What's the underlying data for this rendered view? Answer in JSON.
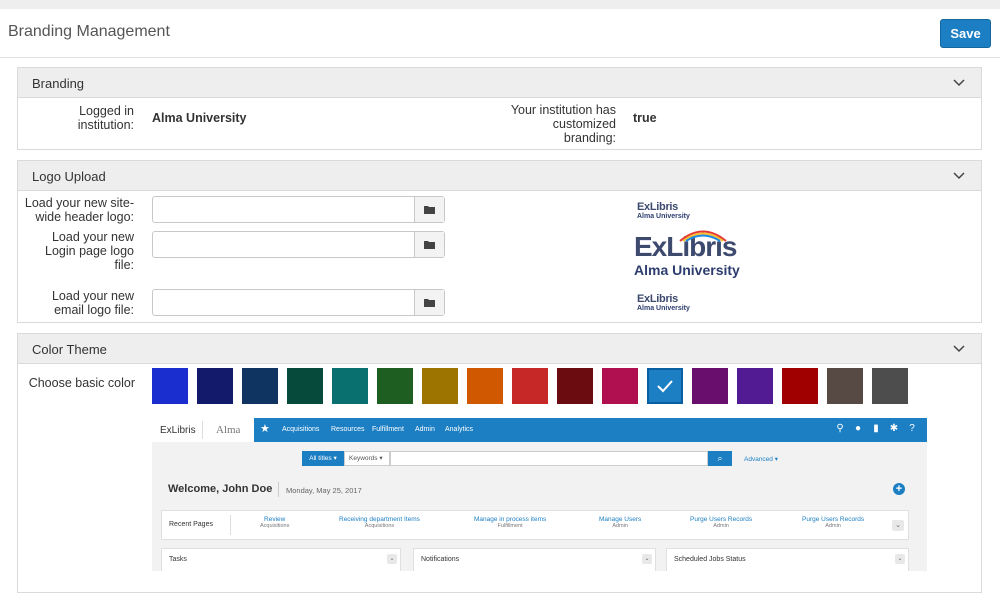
{
  "page": {
    "title": "Branding Management",
    "save_label": "Save"
  },
  "branding": {
    "header": "Branding",
    "logged_label": "Logged in institution:",
    "logged_value": "Alma University",
    "customized_label": "Your institution has customized branding:",
    "customized_value": "true"
  },
  "logo_upload": {
    "header": "Logo Upload",
    "header_logo_label": "Load your new site-wide header logo:",
    "login_logo_label": "Load your new Login page logo file:",
    "email_logo_label": "Load your new email logo file:",
    "logo_brand": "ExLibris",
    "logo_sub": "Alma University"
  },
  "color_theme": {
    "header": "Color Theme",
    "choose_label": "Choose basic color",
    "swatches": [
      "#1a2ecf",
      "#131a6b",
      "#0f3461",
      "#064a3c",
      "#0a6f6f",
      "#1e5e20",
      "#9e7400",
      "#d05800",
      "#c62828",
      "#6b0d10",
      "#b0104f",
      "#1c7fc4",
      "#6a0e6e",
      "#521b93",
      "#a00000",
      "#574a44",
      "#4d4d4d"
    ],
    "selected_index": 11
  },
  "preview": {
    "brand": "ExLibris",
    "alma": "Alma",
    "nav": [
      "Acquisitions",
      "Resources",
      "Fulfillment",
      "Admin",
      "Analytics"
    ],
    "search_scope": "All titles ▾",
    "search_field": "Keywords ▾",
    "advanced": "Advanced ▾",
    "welcome": "Welcome, John Doe",
    "date": "Monday, May 25, 2017",
    "recent_label": "Recent Pages",
    "recent": [
      {
        "title": "Review",
        "sub": "Acquisitions"
      },
      {
        "title": "Receiving department Items",
        "sub": "Acquisitions"
      },
      {
        "title": "Manage in process items",
        "sub": "Fulfillment"
      },
      {
        "title": "Manage Users",
        "sub": "Admin"
      },
      {
        "title": "Purge Users Records",
        "sub": "Admin"
      },
      {
        "title": "Purge Users Records",
        "sub": "Admin"
      }
    ],
    "cards": [
      "Tasks",
      "Notifications",
      "Scheduled Jobs Status"
    ]
  }
}
